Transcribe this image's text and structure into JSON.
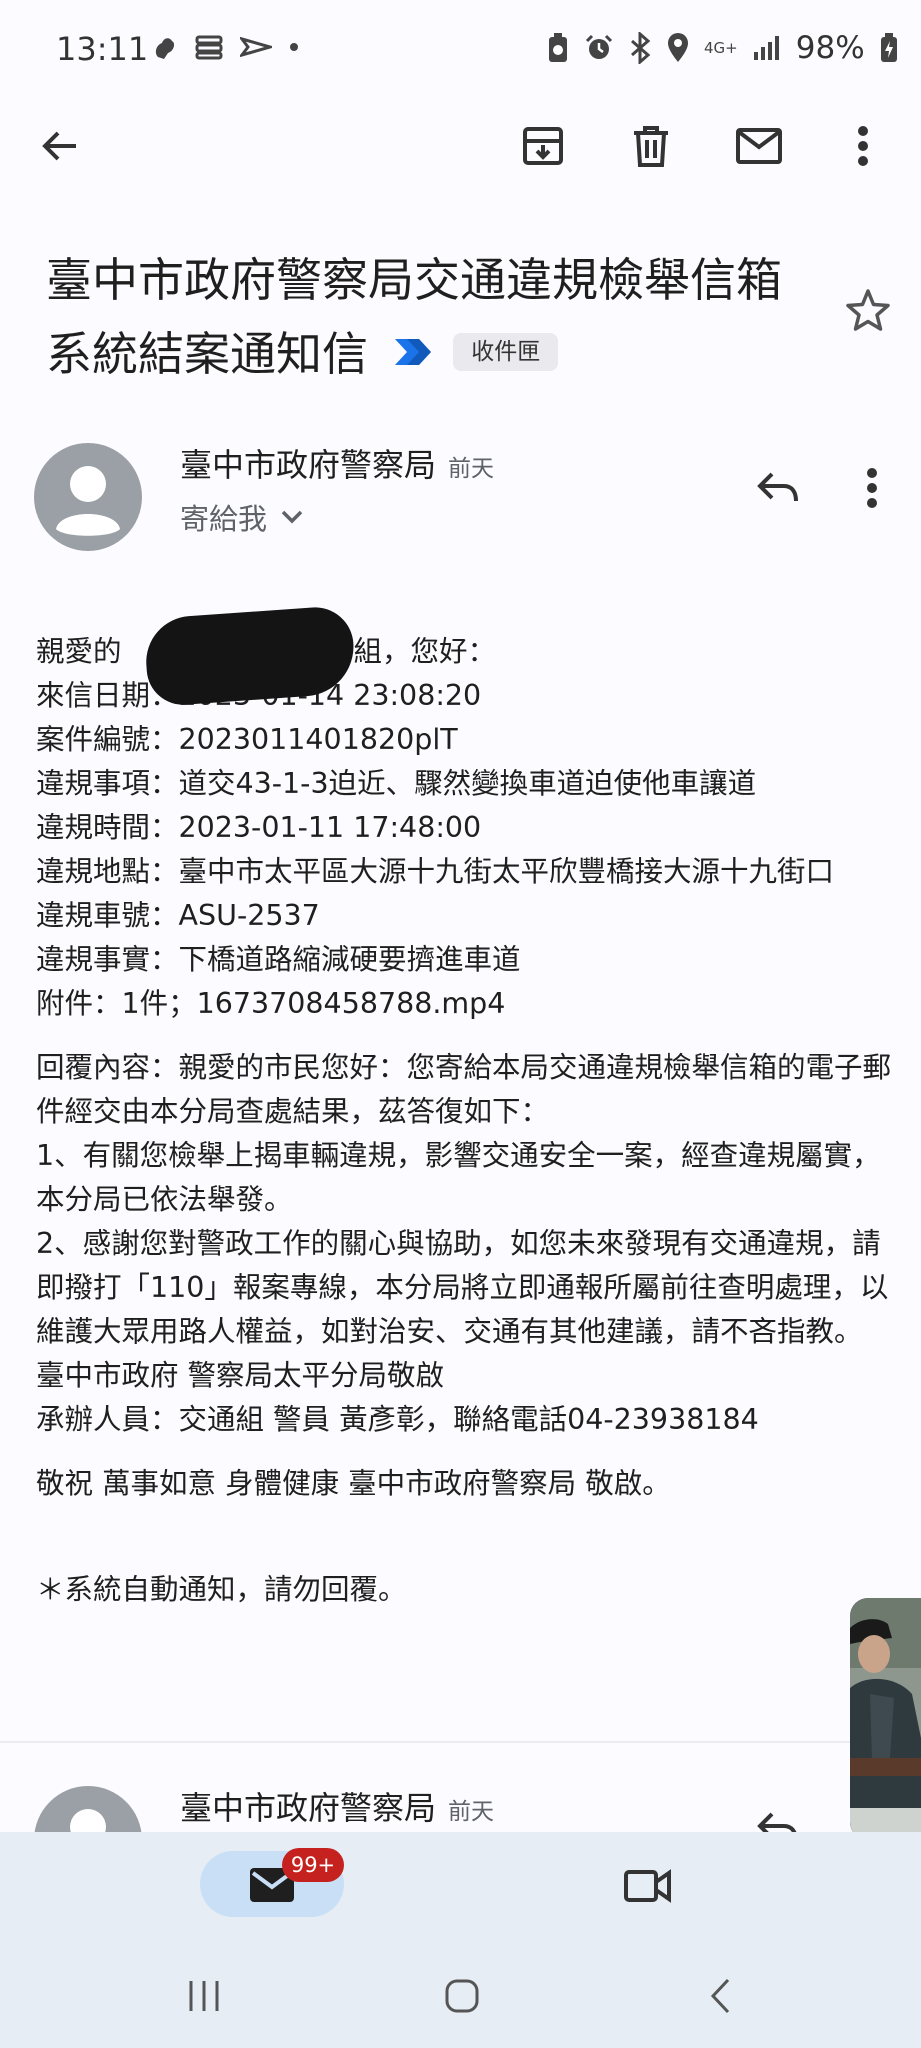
{
  "status_bar": {
    "time": "13:11",
    "network": "4G+",
    "battery": "98%"
  },
  "toolbar": {
    "back": "back-arrow-icon",
    "archive": "archive-icon",
    "delete": "trash-icon",
    "mark_unread": "mail-icon",
    "more": "more-vert-icon"
  },
  "email": {
    "subject_line1": "臺中市政府警察局交通違規檢舉信箱",
    "subject_line2": "系統結案通知信",
    "label": "收件匣",
    "sender": "臺中市政府警察局",
    "when": "前天",
    "to": "寄給我",
    "body": {
      "greeting_prefix": "親愛的",
      "greeting_suffix": "組，您好：",
      "lines": [
        "來信日期：2023-01-14 23:08:20",
        "案件編號：2023011401820plT",
        "違規事項：道交43-1-3迫近、驟然變換車道迫使他車讓道",
        "違規時間：2023-01-11 17:48:00",
        "違規地點：臺中市太平區大源十九街太平欣豐橋接大源十九街口",
        "違規車號：ASU-2537",
        "違規事實：下橋道路縮減硬要擠進車道",
        "附件：1件；1673708458788.mp4"
      ],
      "reply_intro": "回覆內容：親愛的市民您好：您寄給本局交通違規檢舉信箱的電子郵件經交由本分局查處結果，茲答復如下：",
      "reply_1": "1、有關您檢舉上揭車輛違規，影響交通安全一案，經查違規屬實，本分局已依法舉發。",
      "reply_2": "2、感謝您對警政工作的關心與協助，如您未來發現有交通違規，請即撥打「110」報案專線，本分局將立即通報所屬前往查明處理，以維護大眾用路人權益，如對治安、交通有其他建議，請不吝指教。",
      "signoff_1": "臺中市政府 警察局太平分局敬啟",
      "signoff_2": "承辦人員：交通組 警員 黃彥彰，聯絡電話04-23938184",
      "blessing": "敬祝 萬事如意 身體健康 臺中市政府警察局 敬啟。",
      "auto_note": "＊系統自動通知，請勿回覆。"
    }
  },
  "next_email": {
    "sender": "臺中市政府警察局",
    "when": "前天"
  },
  "bottom_nav": {
    "mail_badge": "99+"
  },
  "colors": {
    "background": "#fcfbff",
    "avatar": "#9aa0a6",
    "badge": "#c5221f",
    "nav": "#e6edf5",
    "pill": "#c8dff5",
    "important_marker": "#1a73e8"
  }
}
